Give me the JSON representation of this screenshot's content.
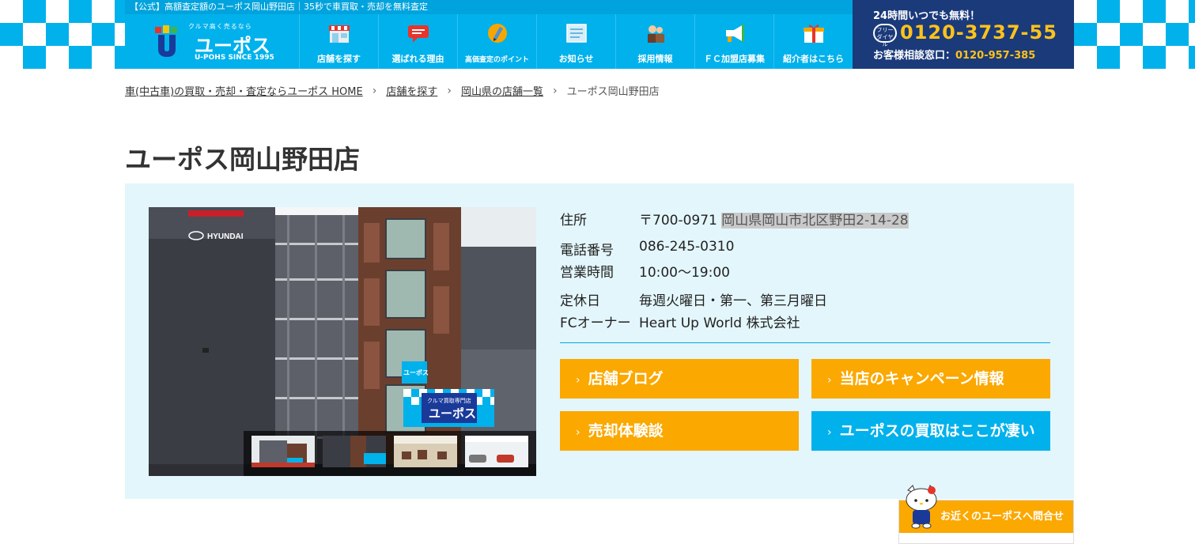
{
  "header": {
    "topbar_text": "【公式】高額査定額のユーポス岡山野田店｜35秒で車買取・売却を無料査定",
    "logo": {
      "tagline": "クルマ高く売るなら",
      "name": "ユーポス",
      "since": "U-POHS SINCE 1995"
    },
    "nav": [
      {
        "label": "店舗を探す",
        "icon": "store-icon"
      },
      {
        "label": "選ばれる理由",
        "icon": "speech-bubble-icon"
      },
      {
        "label": "高価査定のポイント",
        "icon": "pencil-icon"
      },
      {
        "label": "お知らせ",
        "icon": "news-icon"
      },
      {
        "label": "採用情報",
        "icon": "staff-icon"
      },
      {
        "label": "ＦＣ加盟店募集",
        "icon": "megaphone-icon"
      },
      {
        "label": "紹介者はこちら",
        "icon": "gift-icon"
      }
    ],
    "contact": {
      "headline": "24時間いつでも無料！",
      "freedial_label": "フリーダイヤル",
      "phone": "0120-3737-55",
      "sub_label": "お客様相談窓口：",
      "sub_phone": "0120-957-385"
    }
  },
  "breadcrumb": [
    {
      "label": "車(中古車)の買取・売却・査定ならユーポス HOME",
      "link": true
    },
    {
      "label": "店舗を探す",
      "link": true
    },
    {
      "label": "岡山県の店舗一覧",
      "link": true
    },
    {
      "label": "ユーポス岡山野田店",
      "link": false
    }
  ],
  "page_title": "ユーポス岡山野田店",
  "store": {
    "photo_signs": {
      "banner_small": "クルマ買取専門店",
      "banner_name": "ユーポス",
      "sign_side": "ユーポス",
      "brand": "HYUNDAI"
    },
    "address_label": "住所",
    "postal": "〒700-0971",
    "address": "岡山県岡山市北区野田2-14-28",
    "phone_label": "電話番号",
    "phone": "086-245-0310",
    "hours_label": "営業時間",
    "hours": "10:00〜19:00",
    "holiday_label": "定休日",
    "holiday": "毎週火曜日・第一、第三月曜日",
    "owner_label": "FCオーナー",
    "owner": "Heart Up World 株式会社"
  },
  "buttons": {
    "blog": "店舗ブログ",
    "campaign": "当店のキャンペーン情報",
    "reviews": "売却体験談",
    "strength": "ユーポスの買取はここが凄い"
  },
  "floating": {
    "label": "お近くのユーポスへ問合せ"
  },
  "colors": {
    "brand_blue": "#00b1ec",
    "navy": "#1a3a7a",
    "orange": "#fba800",
    "panel_bg": "#e3f6fb"
  }
}
